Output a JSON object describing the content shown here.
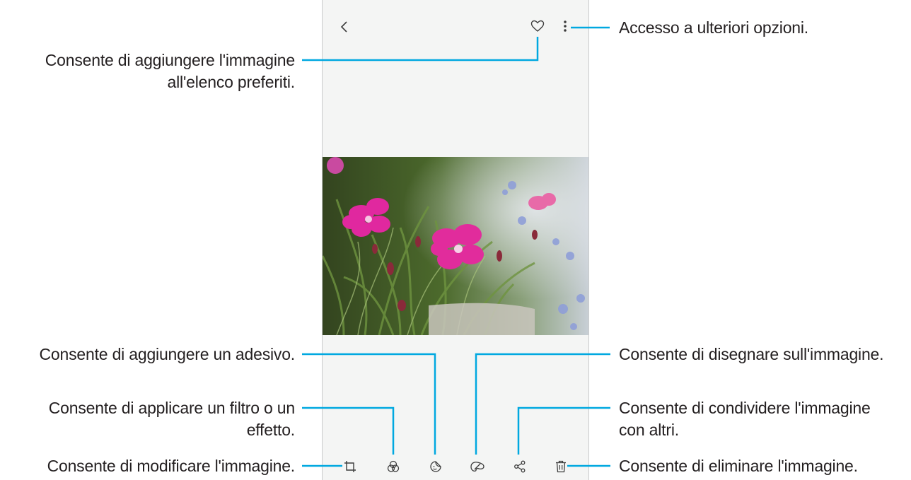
{
  "callouts": {
    "more_options": "Accesso a ulteriori opzioni.",
    "favorite_line1": "Consente di aggiungere l'immagine",
    "favorite_line2": "all'elenco preferiti.",
    "sticker": "Consente di aggiungere un adesivo.",
    "draw": "Consente di disegnare sull'immagine.",
    "filter_line1": "Consente di applicare un filtro o un",
    "filter_line2": "effetto.",
    "share_line1": "Consente di condividere l'immagine",
    "share_line2": "con altri.",
    "edit": "Consente di modificare l'immagine.",
    "delete": "Consente di eliminare l'immagine."
  },
  "icons": {
    "back": "back-chevron-icon",
    "favorite": "heart-icon",
    "more": "more-options-icon",
    "edit": "crop-icon",
    "filter": "filter-icon",
    "sticker": "sticker-icon",
    "draw": "brush-icon",
    "share": "share-icon",
    "delete": "trash-icon"
  },
  "colors": {
    "callout_line": "#00a8e0",
    "phone_bg": "#f4f5f4",
    "icon": "#3c3c3c"
  }
}
